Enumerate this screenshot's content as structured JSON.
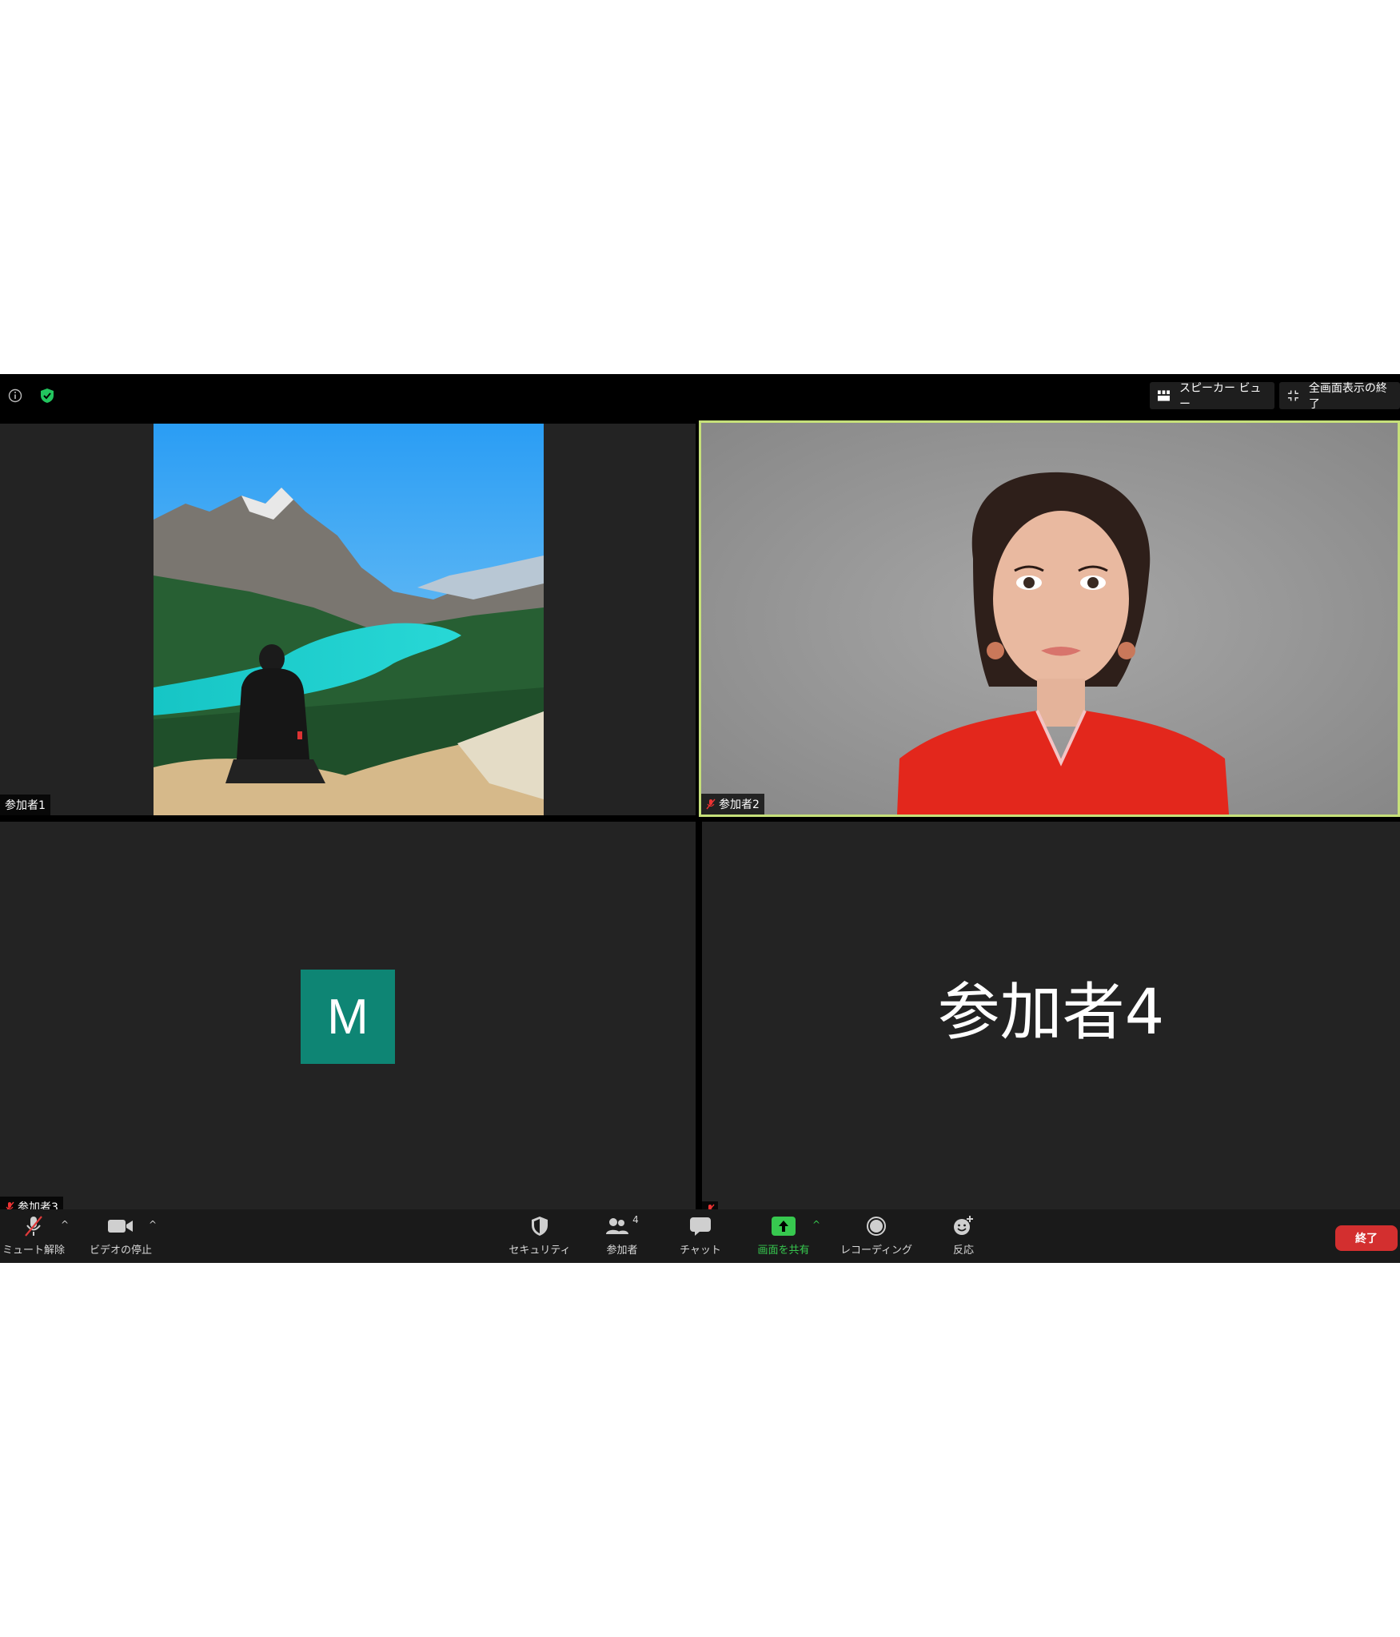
{
  "topbar": {
    "speaker_view_label": "スピーカー ビュー",
    "exit_fullscreen_label": "全画面表示の終了"
  },
  "tiles": {
    "p1": {
      "name": "参加者1"
    },
    "p2": {
      "name": "参加者2"
    },
    "p3": {
      "name": "参加者3",
      "avatar_letter": "M"
    },
    "p4": {
      "name_large": "参加者4"
    }
  },
  "toolbar": {
    "unmute_label": "ミュート解除",
    "video_stop_label": "ビデオの停止",
    "security_label": "セキュリティ",
    "participants_label": "参加者",
    "participants_count": "4",
    "chat_label": "チャット",
    "share_label": "画面を共有",
    "recording_label": "レコーディング",
    "reactions_label": "反応",
    "end_label": "終了"
  },
  "colors": {
    "active_speaker_border": "#c6e07a",
    "avatar_bg": "#0e8574",
    "share_green": "#37c84f",
    "end_red": "#d32f2f",
    "security_shield_green": "#22c55e"
  },
  "icons": {
    "info": "info-icon",
    "security_shield": "shield-check-icon",
    "speaker_view": "grid-icon",
    "exit_fullscreen": "collapse-icon",
    "mic_muted": "mic-muted-icon",
    "video": "video-camera-icon",
    "security": "shield-icon",
    "participants": "people-icon",
    "chat": "chat-bubble-icon",
    "share": "share-screen-icon",
    "record": "record-icon",
    "reactions": "emoji-plus-icon"
  }
}
